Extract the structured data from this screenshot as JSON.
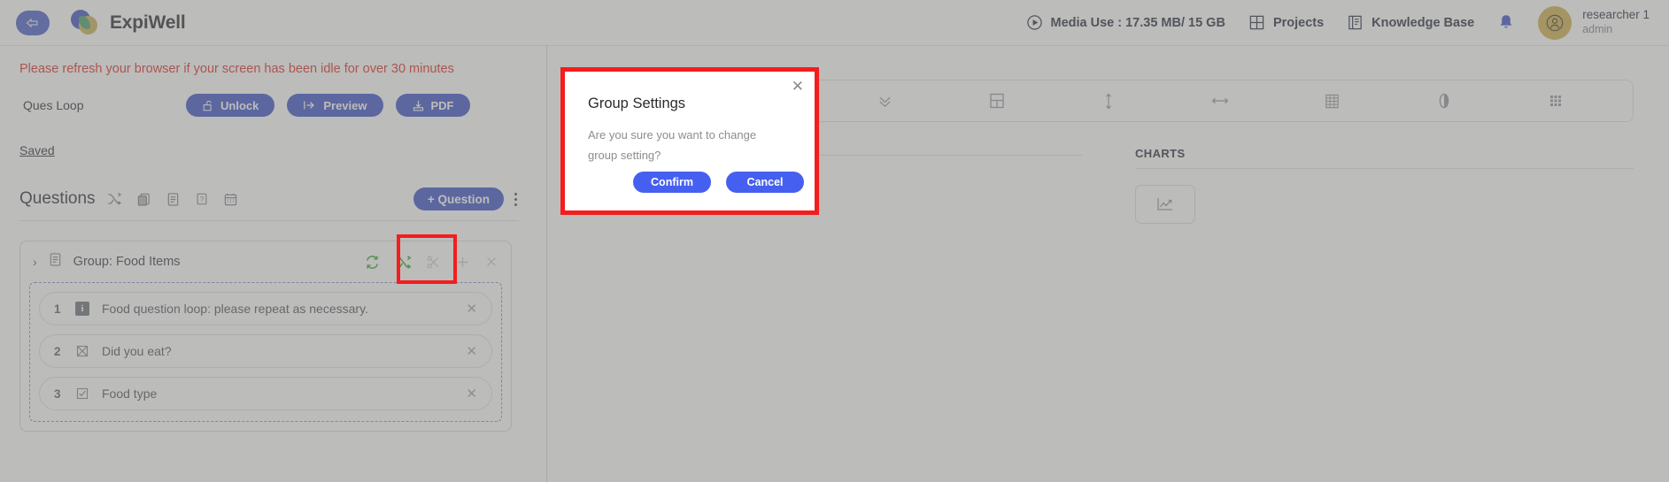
{
  "header": {
    "back_icon": "back-arrow-icon",
    "brand": "ExpiWell",
    "media_use": "Media Use : 17.35 MB/ 15 GB",
    "projects": "Projects",
    "knowledge_base": "Knowledge Base",
    "notifications_icon": "bell-icon",
    "user_name": "researcher 1",
    "user_role": "admin",
    "accent_blue": "#4f63cf",
    "avatar_gold": "#d4b75f"
  },
  "left": {
    "warning": "Please refresh your browser if your screen has been idle for over 30 minutes",
    "loop_label": "Ques Loop",
    "buttons": [
      {
        "label": "Unlock",
        "icon": "unlock-icon"
      },
      {
        "label": "Preview",
        "icon": "preview-icon"
      },
      {
        "label": "PDF",
        "icon": "pdf-icon"
      }
    ],
    "saved": "Saved",
    "questions_title": "Questions",
    "questions_icons": [
      "shuffle-icon",
      "copy-icon",
      "page-icon",
      "help-icon",
      "calendar-icon"
    ],
    "add_question": "+ Question",
    "kebab": "more-options-icon",
    "group": {
      "title": "Group: Food Items",
      "expand_icon": "chevron-right-icon",
      "list_icon": "list-icon",
      "actions": [
        {
          "name": "loop-icon",
          "state": "active"
        },
        {
          "name": "shuffle-icon",
          "state": "active"
        },
        {
          "name": "scissors-icon",
          "state": "dim"
        },
        {
          "name": "add-icon",
          "state": "dim"
        },
        {
          "name": "close-icon",
          "state": "dim"
        }
      ],
      "questions": [
        {
          "num": "1",
          "type_icon": "info-icon",
          "text": "Food question loop: please repeat as necessary."
        },
        {
          "num": "2",
          "type_icon": "multiple-choice-icon",
          "text": "Did you eat?"
        },
        {
          "num": "3",
          "type_icon": "checkbox-icon",
          "text": "Food type"
        }
      ]
    }
  },
  "right": {
    "toolbar_icons": [
      "star-icon",
      "info-icon",
      "chevrons-down-icon",
      "layout-icon",
      "vertical-resize-icon",
      "horizontal-resize-icon",
      "table-image-icon",
      "contrast-icon",
      "grid-icon"
    ],
    "columns": [
      {
        "title": "",
        "tile_icon": "image-placeholder-icon"
      },
      {
        "title": "CHARTS",
        "tile_icon": "chart-icon"
      }
    ]
  },
  "modal": {
    "title": "Group Settings",
    "message": "Are you sure you want to change group setting?",
    "confirm": "Confirm",
    "cancel": "Cancel",
    "close_icon": "close-icon",
    "highlight_color": "#f41d1d",
    "button_color": "#4560f0"
  }
}
